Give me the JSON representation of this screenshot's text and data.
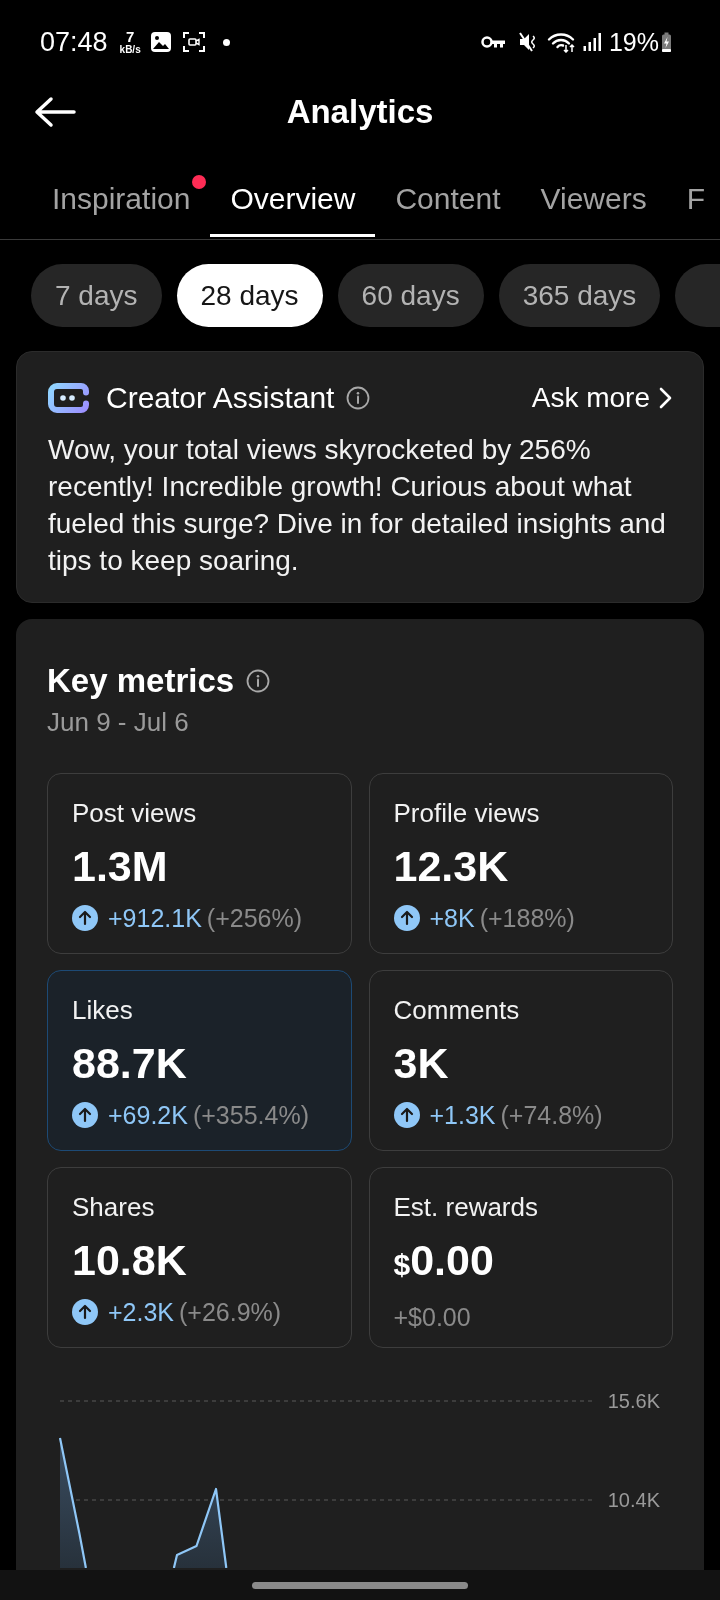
{
  "status_bar": {
    "time": "07:48",
    "net_speed": "7",
    "net_unit": "kB/s",
    "battery": "19%"
  },
  "header": {
    "title": "Analytics"
  },
  "tabs": [
    {
      "label": "Inspiration",
      "selected": false,
      "badge": true
    },
    {
      "label": "Overview",
      "selected": true,
      "badge": false
    },
    {
      "label": "Content",
      "selected": false,
      "badge": false
    },
    {
      "label": "Viewers",
      "selected": false,
      "badge": false
    },
    {
      "label": "F",
      "selected": false,
      "badge": false
    }
  ],
  "date_ranges": [
    {
      "label": "7 days",
      "selected": false
    },
    {
      "label": "28 days",
      "selected": true
    },
    {
      "label": "60 days",
      "selected": false
    },
    {
      "label": "365 days",
      "selected": false
    }
  ],
  "assistant": {
    "title": "Creator Assistant",
    "action": "Ask more",
    "message": "Wow, your total views skyrocketed by 256% recently! Incredible growth! Curious about what fueled this surge? Dive in for detailed insights and tips to keep soaring."
  },
  "key_metrics": {
    "title": "Key metrics",
    "date_range": "Jun 9 - Jul 6",
    "metrics": [
      {
        "label": "Post views",
        "value": "1.3M",
        "increased": true,
        "change": "+912.1K",
        "change_pct": "(+256%)",
        "selected": false
      },
      {
        "label": "Profile views",
        "value": "12.3K",
        "increased": true,
        "change": "+8K",
        "change_pct": "(+188%)",
        "selected": false
      },
      {
        "label": "Likes",
        "value": "88.7K",
        "increased": true,
        "change": "+69.2K",
        "change_pct": "(+355.4%)",
        "selected": true
      },
      {
        "label": "Comments",
        "value": "3K",
        "increased": true,
        "change": "+1.3K",
        "change_pct": "(+74.8%)",
        "selected": false
      },
      {
        "label": "Shares",
        "value": "10.8K",
        "increased": true,
        "change": "+2.3K",
        "change_pct": "(+26.9%)",
        "selected": false
      },
      {
        "label": "Est. rewards",
        "prefix": "$",
        "value": "0.00",
        "increased": false,
        "change": "+$0.00",
        "selected": false
      }
    ],
    "chart": {
      "gridline_labels": [
        "15.6K",
        "10.4K"
      ]
    }
  }
}
